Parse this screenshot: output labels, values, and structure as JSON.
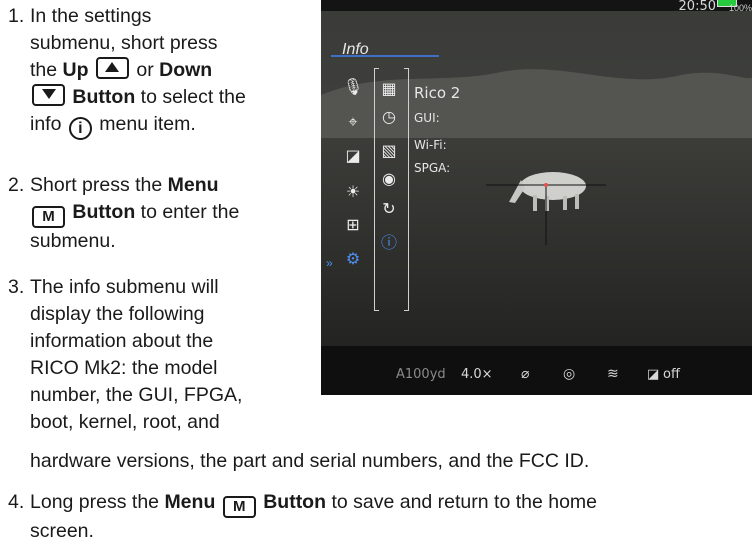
{
  "steps": [
    {
      "number": "1.",
      "lines": [
        "In the settings",
        "submenu, short press",
        "the",
        "Up",
        "or",
        "Down",
        "Button",
        "to select the",
        "info",
        "menu item."
      ]
    },
    {
      "number": "2.",
      "lines": [
        "Short press the",
        "Menu",
        "M",
        "Button",
        "to enter the",
        "submenu."
      ]
    },
    {
      "number": "3.",
      "lines": [
        "The info submenu will",
        "display the following",
        "information about the",
        "RICO Mk2: the model",
        "number, the GUI, FPGA,",
        "boot, kernel, root, and",
        "hardware versions, the part and serial numbers, and the FCC ID."
      ]
    },
    {
      "number": "4.",
      "lines": [
        "Long press the",
        "Menu",
        "M",
        "Button",
        "to save and return to the home",
        "screen."
      ]
    }
  ],
  "screen": {
    "time": "20:50",
    "battery_label": "100%",
    "menu_title": "Info",
    "info_values": [
      "Rico 2",
      "GUI:",
      "Wi-Fi:",
      "SPGA:"
    ],
    "bottom_bar": [
      "A100yd",
      "4.0×",
      "off"
    ],
    "left_icons": [
      "microphone-icon",
      "crosshair-icon",
      "display-off-icon",
      "brightness-icon",
      "zoom-icon",
      "settings-icon"
    ],
    "right_icons": [
      "calendar-icon",
      "clock-icon",
      "palette-icon",
      "globe-icon",
      "reset-icon",
      "info-icon"
    ],
    "accent_color": "#4f8ef0"
  }
}
